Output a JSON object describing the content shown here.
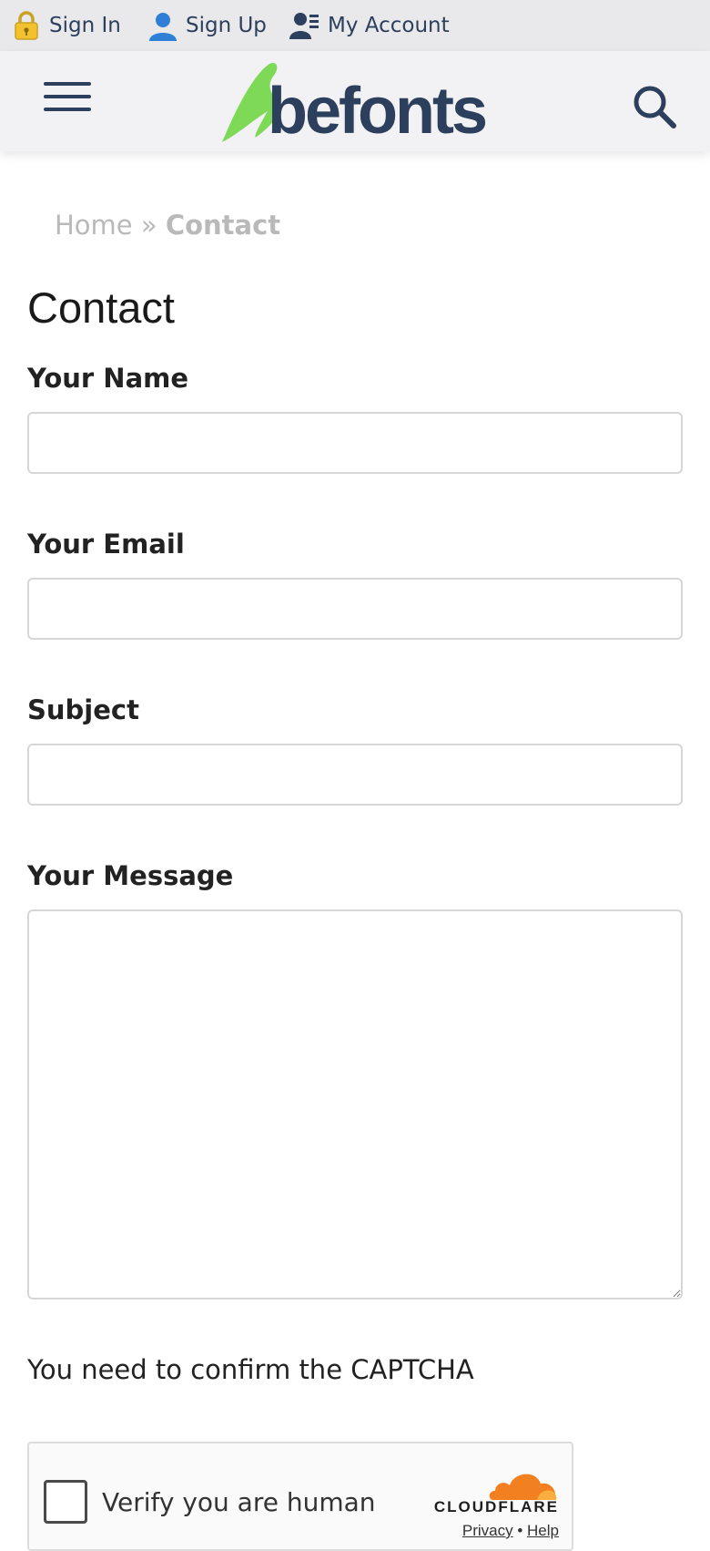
{
  "topbar": {
    "sign_in": "Sign In",
    "sign_up": "Sign Up",
    "my_account": "My Account"
  },
  "header": {
    "logo_text": "befonts",
    "colors": {
      "brand_blue": "#2c3f5c",
      "brand_green": "#7ed957"
    }
  },
  "breadcrumb": {
    "home": "Home",
    "separator": "»",
    "current": "Contact"
  },
  "page": {
    "title": "Contact"
  },
  "form": {
    "name_label": "Your Name",
    "email_label": "Your Email",
    "subject_label": "Subject",
    "message_label": "Your Message",
    "name_value": "",
    "email_value": "",
    "subject_value": "",
    "message_value": ""
  },
  "captcha": {
    "note": "You need to confirm the CAPTCHA",
    "verify_label": "Verify you are human",
    "brand": "CLOUDFLARE",
    "privacy": "Privacy",
    "dot": "•",
    "help": "Help"
  },
  "icons": {
    "sign_in": "lock-icon",
    "sign_up": "user-icon",
    "my_account": "account-icon",
    "menu": "hamburger-icon",
    "search": "search-icon"
  }
}
